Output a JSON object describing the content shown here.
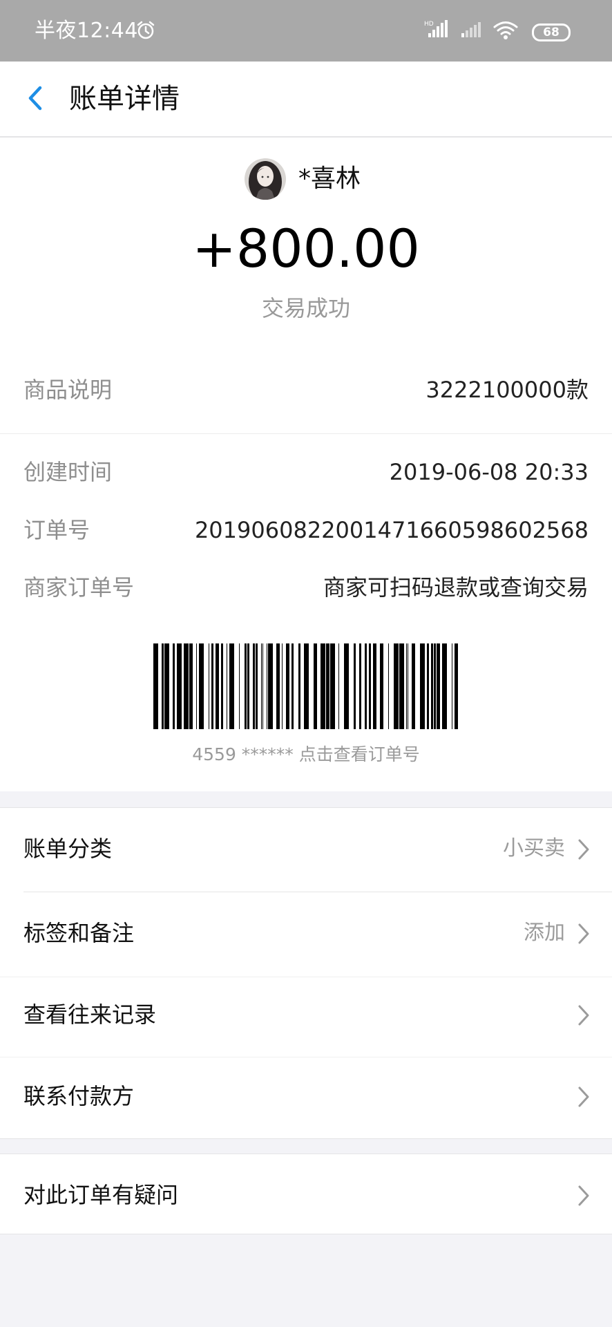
{
  "status_bar": {
    "time": "半夜12:44",
    "alarm_icon": "alarm-clock-icon",
    "signal_icon": "signal-icon",
    "wifi_icon": "wifi-icon",
    "battery": "68"
  },
  "nav": {
    "back_icon": "chevron-left-icon",
    "title": "账单详情",
    "accent_color": "#1e8ee5"
  },
  "summary": {
    "payer_name": "*喜林",
    "amount": "+800.00",
    "status": "交易成功"
  },
  "details": [
    {
      "label": "商品说明",
      "value": "3222100000款"
    },
    {
      "label": "创建时间",
      "value": "2019-06-08 20:33"
    },
    {
      "label": "订单号",
      "value": "20190608220014716605986025​68"
    },
    {
      "label": "商家订单号",
      "value": "商家可扫码退款或查询交易"
    }
  ],
  "barcode": {
    "caption": "4559 ****** 点击查看订单号"
  },
  "menu": [
    {
      "label": "账单分类",
      "value": "小买卖"
    },
    {
      "label": "标签和备注",
      "value": "添加"
    },
    {
      "label": "查看往来记录",
      "value": ""
    },
    {
      "label": "联系付款方",
      "value": ""
    }
  ],
  "question": {
    "label": "对此订单有疑问"
  }
}
